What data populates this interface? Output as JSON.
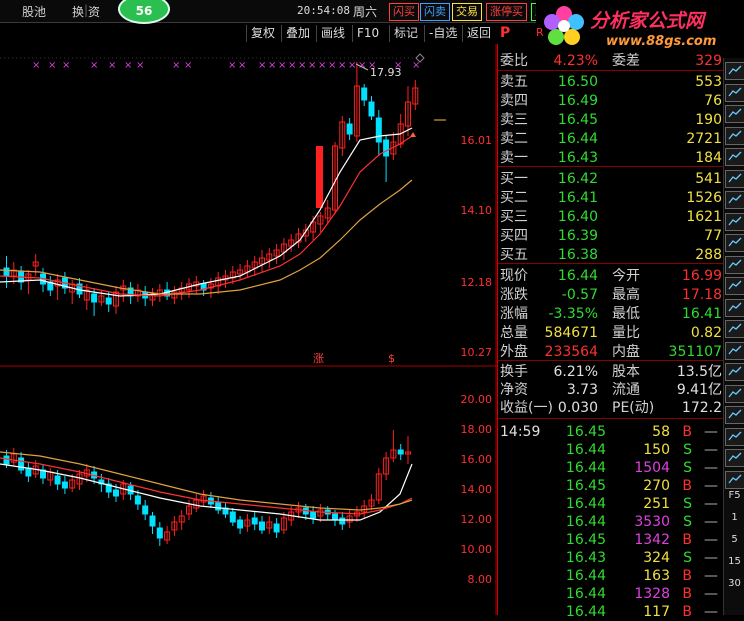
{
  "topbar": {
    "nav": [
      "股池",
      "换",
      "资"
    ],
    "score": "56",
    "clock": "20:54:08",
    "weekday": "周六",
    "buttons": [
      {
        "label": "闪买",
        "color": "#ff4040"
      },
      {
        "label": "闪卖",
        "color": "#40a0ff"
      },
      {
        "label": "交易",
        "color": "#ffe040"
      },
      {
        "label": "涨停买",
        "color": "#ff4040"
      },
      {
        "label": "跌",
        "color": "#40ff40"
      }
    ]
  },
  "logo": {
    "name": "分析家公式网",
    "url": "www.88gs.com"
  },
  "toolbar2": [
    "复权",
    "叠加",
    "画线",
    "F10",
    "标记",
    "-自选",
    "返回"
  ],
  "chart": {
    "main_right_labels": [
      "16.01",
      "14.10",
      "12.18",
      "10.27"
    ],
    "sub_right_labels": [
      "20.00",
      "18.00",
      "16.00",
      "14.00",
      "12.00",
      "10.00",
      "8.00"
    ],
    "high_annotation": "17.93",
    "markers": [
      "涨",
      "$"
    ],
    "colors": {
      "up": "#ff2020",
      "down": "#00e0ff",
      "ma1": "#ffffff",
      "ma2": "#ff3030",
      "ma3": "#e0a040",
      "signal": "#e040e0"
    }
  },
  "quote": {
    "header_mark": "P",
    "header_mark2": "R",
    "wei_bi": {
      "label": "委比",
      "value": "4.23%",
      "label2": "委差",
      "value2": "329"
    },
    "sells": [
      {
        "label": "卖五",
        "price": "16.50",
        "vol": "553"
      },
      {
        "label": "卖四",
        "price": "16.49",
        "vol": "76"
      },
      {
        "label": "卖三",
        "price": "16.45",
        "vol": "190"
      },
      {
        "label": "卖二",
        "price": "16.44",
        "vol": "2721"
      },
      {
        "label": "卖一",
        "price": "16.43",
        "vol": "184"
      }
    ],
    "buys": [
      {
        "label": "买一",
        "price": "16.42",
        "vol": "541"
      },
      {
        "label": "买二",
        "price": "16.41",
        "vol": "1526"
      },
      {
        "label": "买三",
        "price": "16.40",
        "vol": "1621"
      },
      {
        "label": "买四",
        "price": "16.39",
        "vol": "77"
      },
      {
        "label": "买五",
        "price": "16.38",
        "vol": "288"
      }
    ],
    "stats": [
      {
        "l1": "现价",
        "v1": "16.44",
        "c1": "g",
        "l2": "今开",
        "v2": "16.99",
        "c2": "r"
      },
      {
        "l1": "涨跌",
        "v1": "-0.57",
        "c1": "g",
        "l2": "最高",
        "v2": "17.18",
        "c2": "r"
      },
      {
        "l1": "涨幅",
        "v1": "-3.35%",
        "c1": "g",
        "l2": "最低",
        "v2": "16.41",
        "c2": "g"
      },
      {
        "l1": "总量",
        "v1": "584671",
        "c1": "y",
        "l2": "量比",
        "v2": "0.82",
        "c2": "y"
      },
      {
        "l1": "外盘",
        "v1": "233564",
        "c1": "r",
        "l2": "内盘",
        "v2": "351107",
        "c2": "g"
      }
    ],
    "finance": [
      {
        "l1": "换手",
        "v1": "6.21%",
        "l2": "股本",
        "v2": "13.5亿"
      },
      {
        "l1": "净资",
        "v1": "3.73",
        "l2": "流通",
        "v2": "9.41亿"
      },
      {
        "l1": "收益(一)",
        "v1": "0.030",
        "l2": "PE(动)",
        "v2": "172.2"
      }
    ],
    "ticks": [
      {
        "time": "14:59",
        "price": "16.45",
        "vol": "58",
        "vc": "y",
        "bs": "B"
      },
      {
        "time": "",
        "price": "16.44",
        "vol": "150",
        "vc": "y",
        "bs": "S"
      },
      {
        "time": "",
        "price": "16.44",
        "vol": "1504",
        "vc": "m",
        "bs": "S"
      },
      {
        "time": "",
        "price": "16.45",
        "vol": "270",
        "vc": "y",
        "bs": "B"
      },
      {
        "time": "",
        "price": "16.44",
        "vol": "251",
        "vc": "y",
        "bs": "S"
      },
      {
        "time": "",
        "price": "16.44",
        "vol": "3530",
        "vc": "m",
        "bs": "S"
      },
      {
        "time": "",
        "price": "16.45",
        "vol": "1342",
        "vc": "m",
        "bs": "B"
      },
      {
        "time": "",
        "price": "16.43",
        "vol": "324",
        "vc": "y",
        "bs": "S"
      },
      {
        "time": "",
        "price": "16.44",
        "vol": "163",
        "vc": "y",
        "bs": "B"
      },
      {
        "time": "",
        "price": "16.44",
        "vol": "1328",
        "vc": "m",
        "bs": "B"
      },
      {
        "time": "",
        "price": "16.44",
        "vol": "117",
        "vc": "y",
        "bs": "B"
      }
    ]
  },
  "sidebar": {
    "icons": [
      "k-line-icon",
      "tick-chart-icon",
      "intraday-icon",
      "list-icon",
      "grid-icon",
      "wave-chart-icon",
      "trend-icon",
      "cross-icon",
      "news-icon",
      "f10-icon",
      "folder-icon",
      "f-icon",
      "candles-icon",
      "eraser-icon",
      "line-up-icon",
      "rsi-icon",
      "bars-icon",
      "tools-icon",
      "move-icon",
      "pen-icon"
    ],
    "texts": [
      "F5",
      "1",
      "5",
      "15",
      "30"
    ]
  }
}
